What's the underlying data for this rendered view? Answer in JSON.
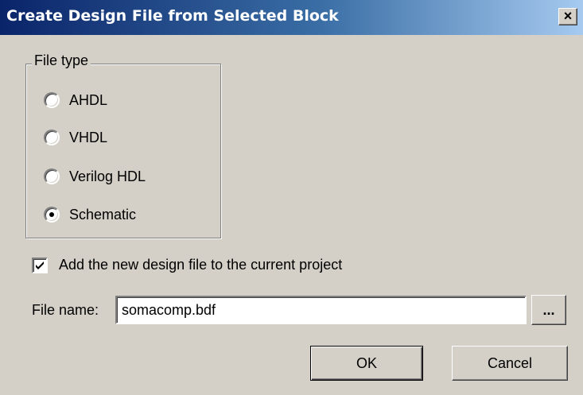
{
  "window": {
    "title": "Create Design File from Selected Block",
    "close_glyph": "×",
    "close_icon": "close-icon"
  },
  "file_type": {
    "legend": "File type",
    "options": [
      {
        "label": "AHDL",
        "selected": false
      },
      {
        "label": "VHDL",
        "selected": false
      },
      {
        "label": "Verilog HDL",
        "selected": false
      },
      {
        "label": "Schematic",
        "selected": true
      }
    ]
  },
  "add_to_project": {
    "label": "Add the new design file to the current project",
    "checked": true
  },
  "file_name": {
    "label": "File name:",
    "value": "somacomp.bdf",
    "browse_label": "..."
  },
  "buttons": {
    "ok_label": "OK",
    "cancel_label": "Cancel"
  }
}
